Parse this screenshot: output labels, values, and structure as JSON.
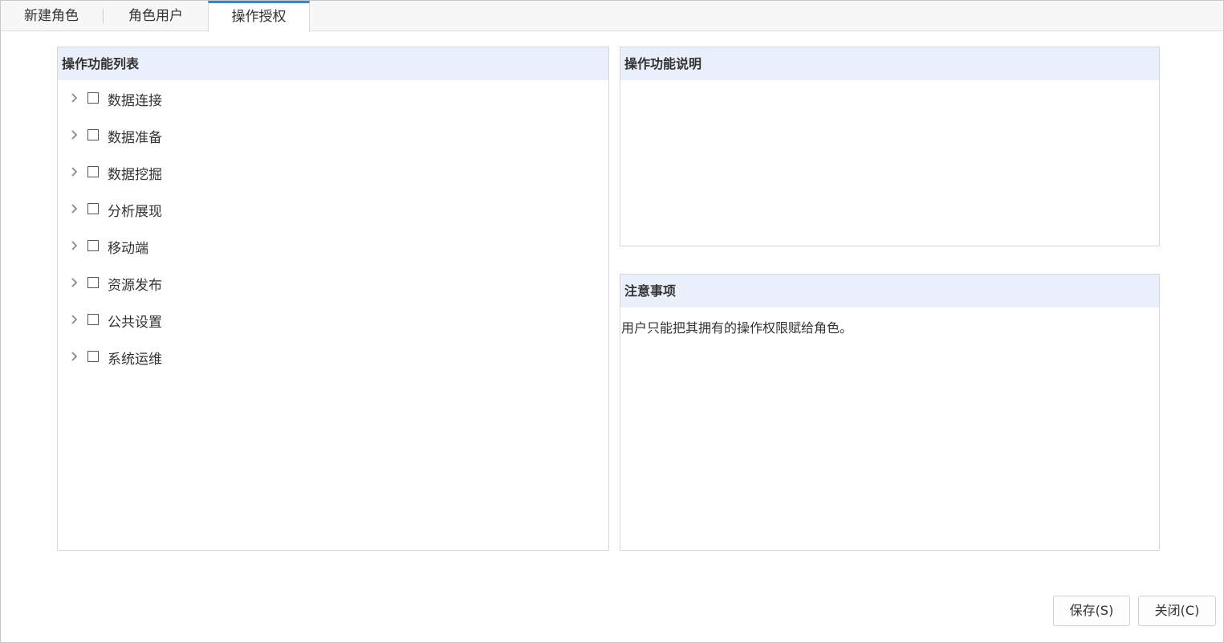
{
  "tabs": [
    {
      "label": "新建角色"
    },
    {
      "label": "角色用户"
    },
    {
      "label": "操作授权"
    }
  ],
  "active_tab": "操作授权",
  "function_list": {
    "title": "操作功能列表",
    "items": [
      {
        "label": "数据连接",
        "checked": false,
        "expanded": false
      },
      {
        "label": "数据准备",
        "checked": false,
        "expanded": false
      },
      {
        "label": "数据挖掘",
        "checked": false,
        "expanded": false
      },
      {
        "label": "分析展现",
        "checked": false,
        "expanded": false
      },
      {
        "label": "移动端",
        "checked": false,
        "expanded": false
      },
      {
        "label": "资源发布",
        "checked": false,
        "expanded": false
      },
      {
        "label": "公共设置",
        "checked": false,
        "expanded": false
      },
      {
        "label": "系统运维",
        "checked": false,
        "expanded": false
      }
    ]
  },
  "function_desc": {
    "title": "操作功能说明"
  },
  "notes": {
    "title": "注意事项",
    "text": "用户只能把其拥有的操作权限赋给角色。"
  },
  "buttons": {
    "save_label": "保存(S)",
    "close_label": "关闭(C)"
  },
  "colors": {
    "active_tab_border": "#3d82c4",
    "panel_header_bg": "#eaf0fb"
  }
}
